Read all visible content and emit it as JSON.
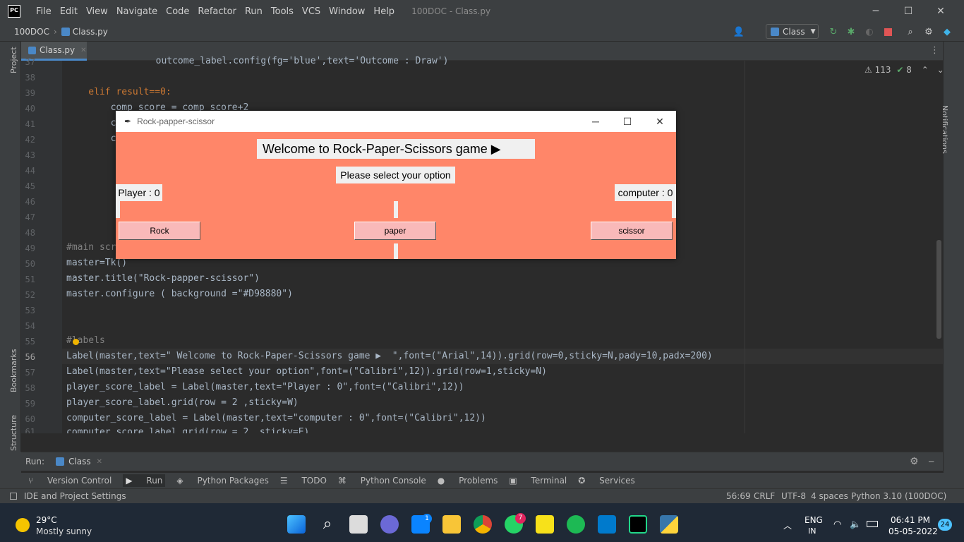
{
  "ide": {
    "logo": "PC",
    "menu": [
      "File",
      "Edit",
      "View",
      "Navigate",
      "Code",
      "Refactor",
      "Run",
      "Tools",
      "VCS",
      "Window",
      "Help"
    ],
    "window_title": "100DOC - Class.py",
    "breadcrumb_project": "100DOC",
    "breadcrumb_file": "Class.py",
    "run_config": "Class",
    "tab_label": "Class.py",
    "inspections_warnings": "113",
    "inspections_ok": "8",
    "left_tools": [
      "Project",
      "Bookmarks",
      "Structure"
    ],
    "right_tools": [
      "Notifications"
    ]
  },
  "code_lines": [
    {
      "n": "37",
      "text": "        outcome_label.config(fg='blue',text='Outcome : Draw')"
    },
    {
      "n": "38",
      "text": ""
    },
    {
      "n": "39",
      "text": "    elif result==0:"
    },
    {
      "n": "40",
      "text": "        comp_score = comp_score+2"
    },
    {
      "n": "41",
      "text": "        c"
    },
    {
      "n": "42",
      "text": "        c"
    },
    {
      "n": "43",
      "text": ""
    },
    {
      "n": "44",
      "text": ""
    },
    {
      "n": "45",
      "text": ""
    },
    {
      "n": "46",
      "text": ""
    },
    {
      "n": "47",
      "text": ""
    },
    {
      "n": "48",
      "text": ""
    },
    {
      "n": "49",
      "text": "#main scr"
    },
    {
      "n": "50",
      "text": "master=Tk()"
    },
    {
      "n": "51",
      "text": "master.title(\"Rock-papper-scissor\")"
    },
    {
      "n": "52",
      "text": "master.configure ( background =\"#D98880\")"
    },
    {
      "n": "53",
      "text": ""
    },
    {
      "n": "54",
      "text": ""
    },
    {
      "n": "55",
      "text": "#labels"
    },
    {
      "n": "56",
      "text": "Label(master,text=\" Welcome to Rock-Paper-Scissors game ▶  \",font=(\"Arial\",14)).grid(row=0,sticky=N,pady=10,padx=200)"
    },
    {
      "n": "57",
      "text": "Label(master,text=\"Please select your option\",font=(\"Calibri\",12)).grid(row=1,sticky=N)"
    },
    {
      "n": "58",
      "text": "player_score_label = Label(master,text=\"Player : 0\",font=(\"Calibri\",12))"
    },
    {
      "n": "59",
      "text": "player_score_label.grid(row = 2 ,sticky=W)"
    },
    {
      "n": "60",
      "text": "computer_score_label = Label(master,text=\"computer : 0\",font=(\"Calibri\",12))"
    },
    {
      "n": "61",
      "text": "computer_score_label.grid(row = 2 ,sticky=E)"
    }
  ],
  "tk": {
    "title": "Rock-papper-scissor",
    "welcome": "Welcome to Rock-Paper-Scissors game ▶",
    "prompt": "Please select your option",
    "player_score": "Player : 0",
    "computer_score": "computer : 0",
    "btn_rock": "Rock",
    "btn_paper": "paper",
    "btn_scissor": "scissor",
    "bg_color": "#ff8669"
  },
  "run_panel": {
    "label": "Run:",
    "config_tab": "Class"
  },
  "bottom_tabs": [
    "Version Control",
    "Run",
    "Python Packages",
    "TODO",
    "Python Console",
    "Problems",
    "Terminal",
    "Services"
  ],
  "status": {
    "left": "IDE and Project Settings",
    "position": "56:69",
    "line_sep": "CRLF",
    "encoding": "UTF-8",
    "indent": "4 spaces",
    "interpreter": "Python 3.10 (100DOC)"
  },
  "taskbar": {
    "temp": "29°C",
    "weather": "Mostly sunny",
    "lang": "ENG",
    "region": "IN",
    "time": "06:41 PM",
    "date": "05-05-2022",
    "notif_count": "24",
    "whatsapp_badge": "7",
    "mail_badge": "1"
  }
}
